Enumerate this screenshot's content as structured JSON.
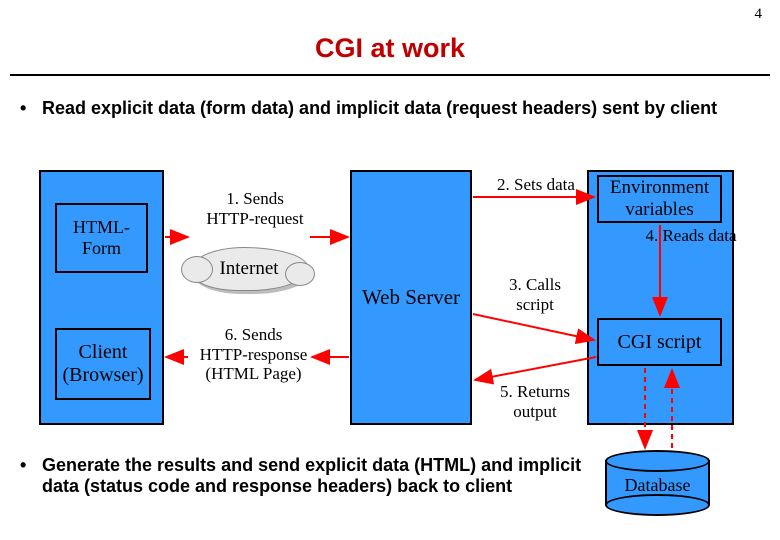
{
  "page_number": "4",
  "title": "CGI at work",
  "bullets": {
    "b1": "Read explicit data (form data) and implicit data (request headers) sent by client",
    "b2": "Generate the results and send explicit data (HTML) and implicit data (status code and response headers) back to client"
  },
  "boxes": {
    "html_form": "HTML-\nForm",
    "client_browser": "Client\n(Browser)",
    "internet": "Internet",
    "web_server": "Web Server",
    "env_vars": "Environment\nvariables",
    "cgi_script": "CGI script",
    "database": "Database"
  },
  "labels": {
    "step1": "1. Sends\nHTTP-request",
    "step2": "2. Sets data",
    "step3": "3. Calls\nscript",
    "step4": "4. Reads data",
    "step5": "5. Returns\noutput",
    "step6": "6. Sends\nHTTP-response\n(HTML Page)"
  },
  "colors": {
    "box_fill": "#3399ff",
    "arrow": "#ff0000",
    "title": "#c00000"
  }
}
